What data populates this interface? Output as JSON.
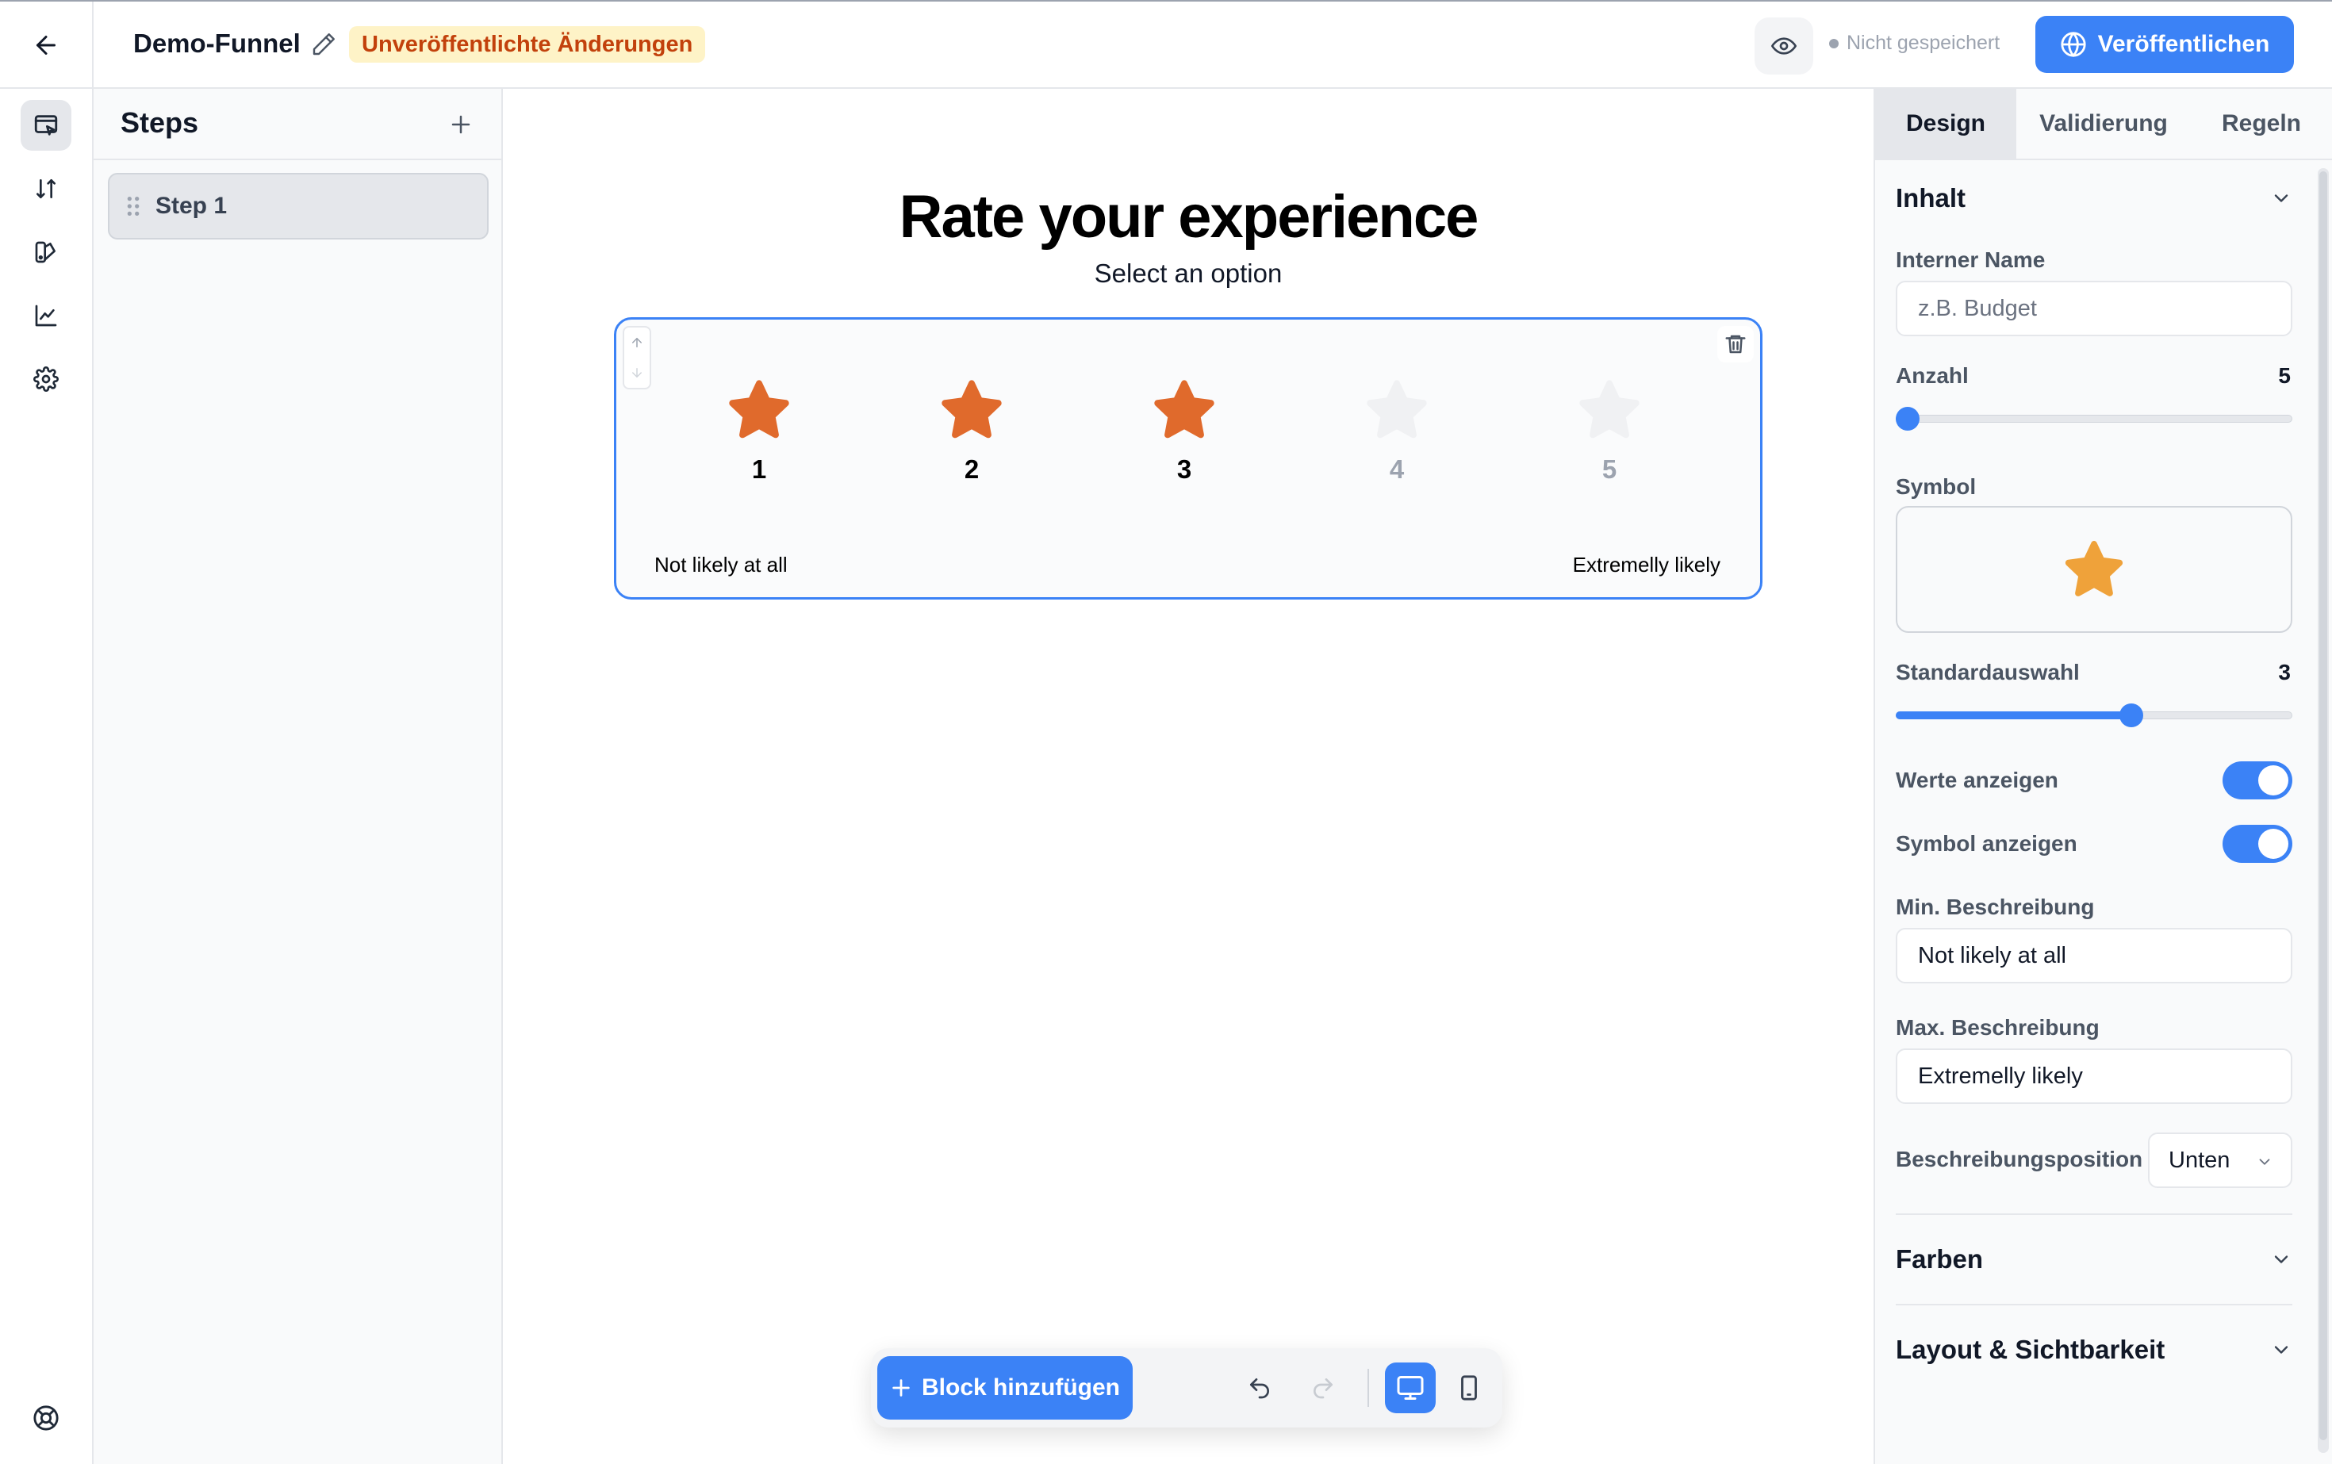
{
  "header": {
    "title": "Demo-Funnel",
    "badge": "Unveröffentlichte Änderungen",
    "save_status": "Nicht gespeichert",
    "publish_label": "Veröffentlichen"
  },
  "rail": {
    "items": [
      "editor-icon",
      "sort-icon",
      "design-icon",
      "analytics-icon",
      "settings-icon"
    ],
    "bottom": "help-icon"
  },
  "steps": {
    "title": "Steps",
    "items": [
      {
        "label": "Step 1"
      }
    ]
  },
  "canvas": {
    "title": "Rate your experience",
    "subtitle": "Select an option",
    "rating": {
      "count": 5,
      "selected": 3,
      "options": [
        {
          "value": "1"
        },
        {
          "value": "2"
        },
        {
          "value": "3"
        },
        {
          "value": "4"
        },
        {
          "value": "5"
        }
      ],
      "min_description": "Not likely at all",
      "max_description": "Extremelly likely",
      "colors": {
        "active": "#E06A2C",
        "inactive": "#F0F1F3",
        "active_text": "#000000",
        "inactive_text": "#9CA3AF"
      }
    }
  },
  "toolbar": {
    "add_block_label": "Block hinzufügen"
  },
  "panel": {
    "tabs": [
      "Design",
      "Validierung",
      "Regeln"
    ],
    "active_tab": "Design",
    "section_content": "Inhalt",
    "internal_name_label": "Interner Name",
    "internal_name_placeholder": "z.B. Budget",
    "count_label": "Anzahl",
    "count_value": "5",
    "count_level": 0.0,
    "symbol_label": "Symbol",
    "symbol_color": "#EFA23A",
    "default_label": "Standardauswahl",
    "default_value": "3",
    "default_level": 0.6,
    "show_values_label": "Werte anzeigen",
    "show_values": true,
    "show_symbol_label": "Symbol anzeigen",
    "show_symbol": true,
    "min_desc_label": "Min. Beschreibung",
    "min_desc_value": "Not likely at all",
    "max_desc_label": "Max. Beschreibung",
    "max_desc_value": "Extremelly likely",
    "position_label": "Beschreibungsposition",
    "position_value": "Unten",
    "section_colors": "Farben",
    "section_layout": "Layout & Sichtbarkeit"
  },
  "colors": {
    "accent": "#3B82F6",
    "badge_bg": "#FEF3C7",
    "badge_text": "#C2410C"
  }
}
